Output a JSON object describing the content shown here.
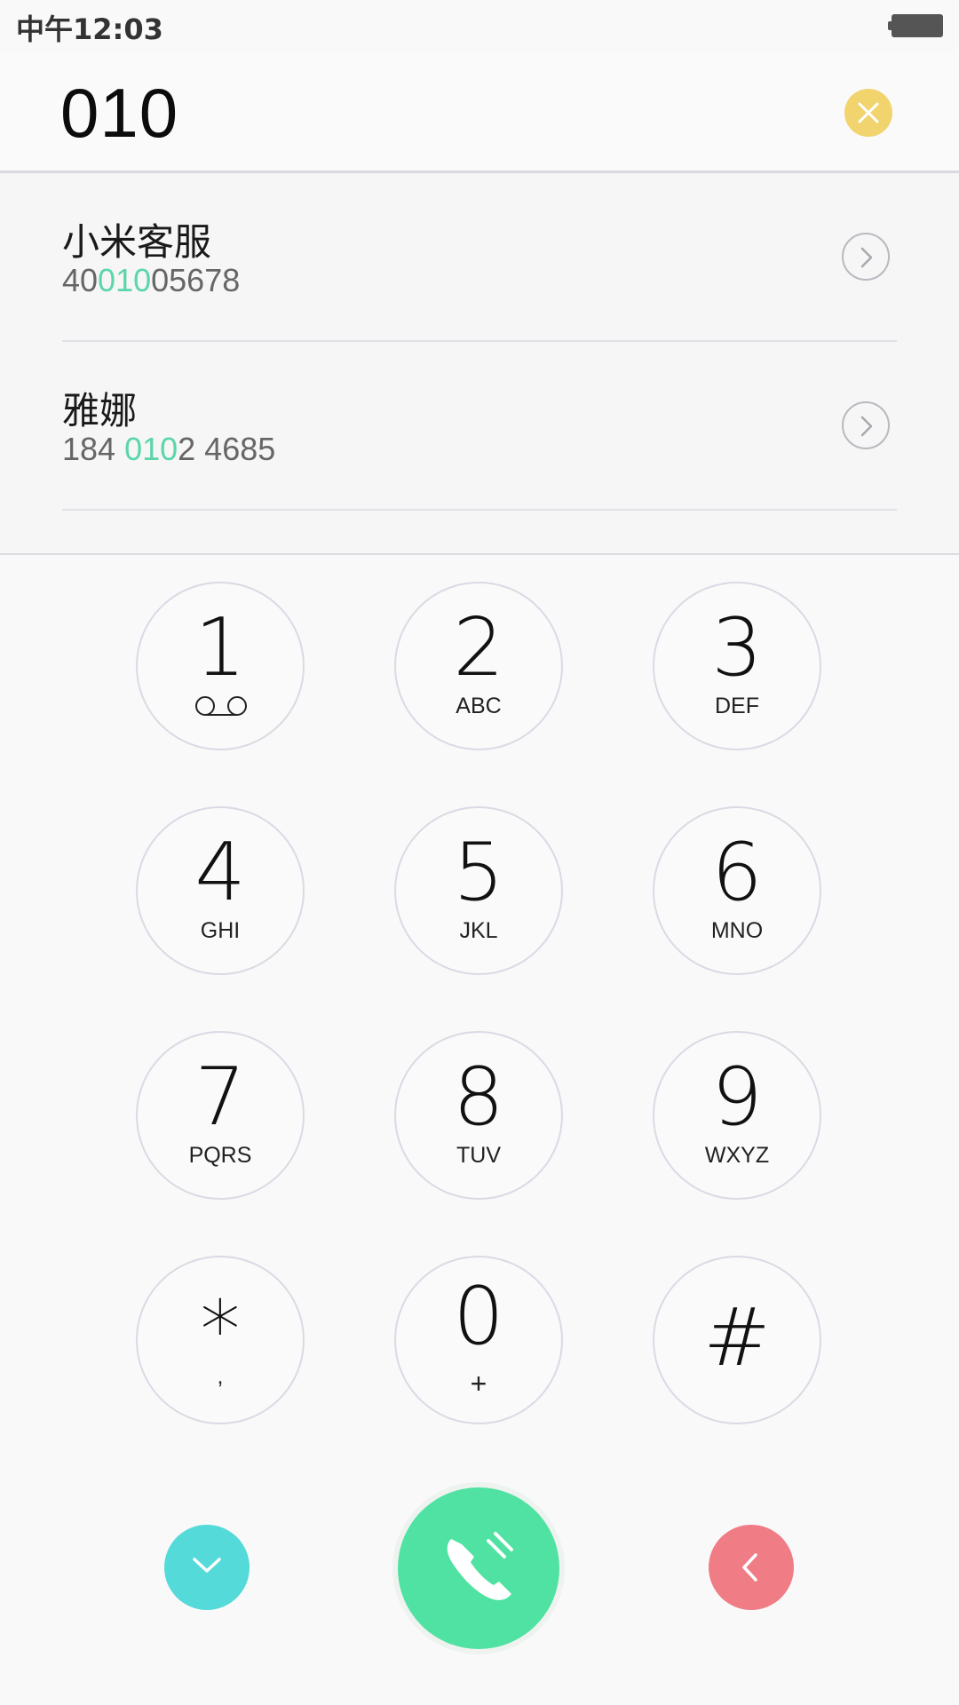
{
  "status_bar": {
    "time": "中午12:03"
  },
  "dialer": {
    "dialed_number": "010",
    "clear_icon": "close-icon",
    "clear_color": "#f2d46e"
  },
  "results": [
    {
      "name": "小米客服",
      "number_before": "40",
      "number_match": "010",
      "number_after": "05678",
      "detail_icon": "chevron-right-icon"
    },
    {
      "name": "雅娜",
      "number_before": "184 ",
      "number_match": "010",
      "number_after": "2 4685",
      "detail_icon": "chevron-right-icon"
    }
  ],
  "match_color": "#5cd6a8",
  "keypad": {
    "keys": [
      {
        "digit": "1",
        "letters": "",
        "icon": "voicemail-icon"
      },
      {
        "digit": "2",
        "letters": "ABC"
      },
      {
        "digit": "3",
        "letters": "DEF"
      },
      {
        "digit": "4",
        "letters": "GHI"
      },
      {
        "digit": "5",
        "letters": "JKL"
      },
      {
        "digit": "6",
        "letters": "MNO"
      },
      {
        "digit": "7",
        "letters": "PQRS"
      },
      {
        "digit": "8",
        "letters": "TUV"
      },
      {
        "digit": "9",
        "letters": "WXYZ"
      },
      {
        "digit": "*",
        "letters": ","
      },
      {
        "digit": "0",
        "letters": "+"
      },
      {
        "digit": "#",
        "letters": ""
      }
    ]
  },
  "actions": {
    "hide_keypad_icon": "chevron-down-icon",
    "hide_keypad_color": "#54dad8",
    "call_icon": "phone-icon",
    "call_color": "#4fe2a2",
    "backspace_icon": "chevron-left-icon",
    "backspace_color": "#f07c86"
  }
}
